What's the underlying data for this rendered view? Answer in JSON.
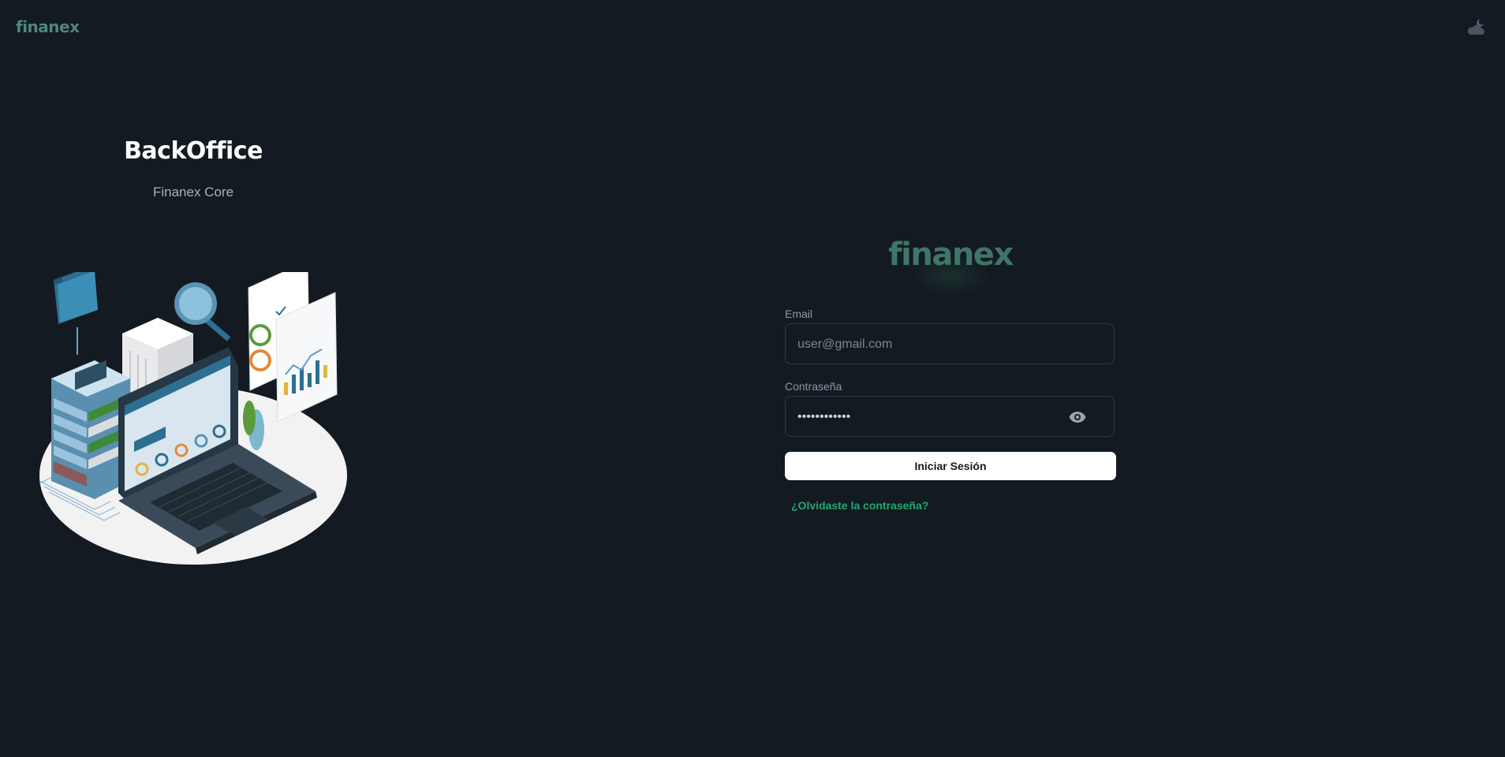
{
  "header": {
    "logo_text": "finanex",
    "theme_toggle_icon": "moon-cloud-icon"
  },
  "hero": {
    "title": "BackOffice",
    "subtitle": "Finanex Core",
    "illustration": "isometric-laptop-servers-illustration"
  },
  "login": {
    "logo_text": "finanex",
    "email": {
      "label": "Email",
      "placeholder": "user@gmail.com",
      "value": ""
    },
    "password": {
      "label": "Contraseña",
      "value": "••••••••••••",
      "toggle_icon": "eye-icon"
    },
    "submit_label": "Iniciar Sesión",
    "forgot_label": "¿Olvidaste la contraseña?"
  },
  "colors": {
    "background": "#141a21",
    "brand": "#4f8677",
    "link": "#1fa972",
    "button": "#ffffff"
  }
}
